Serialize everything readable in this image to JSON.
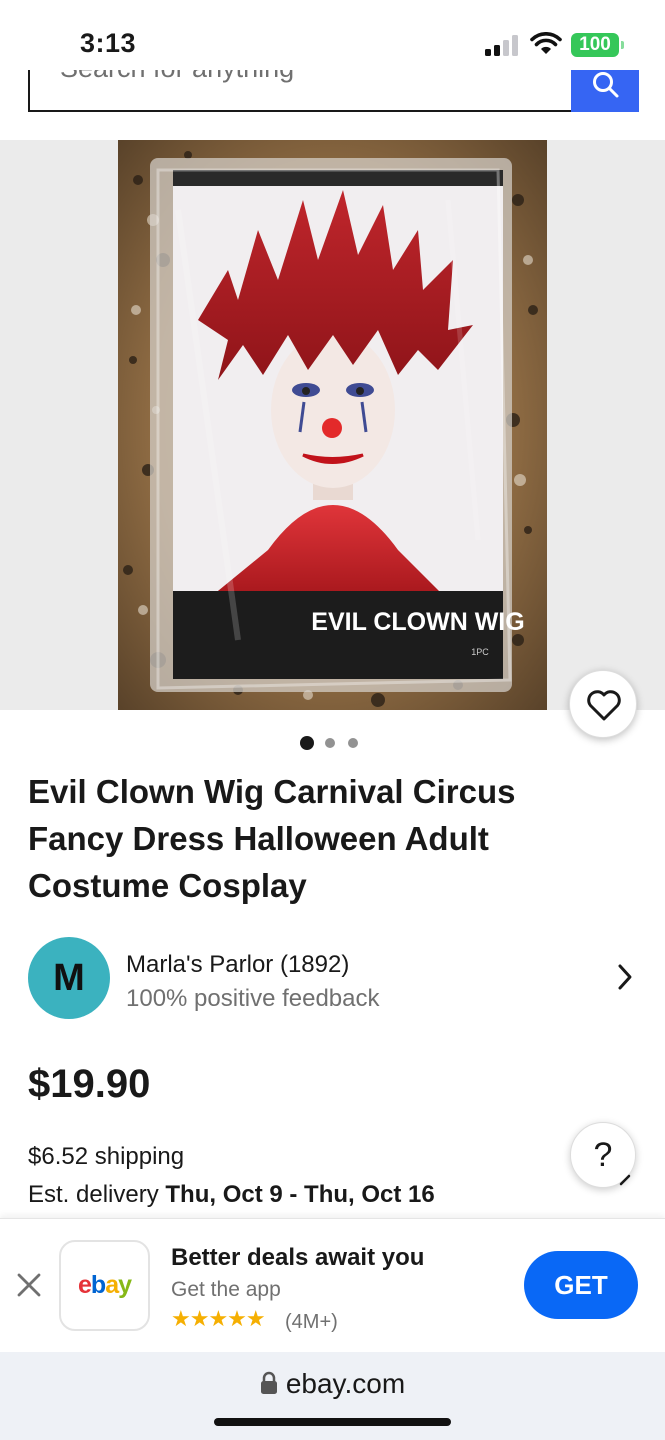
{
  "status_bar": {
    "time": "3:13",
    "battery": "100"
  },
  "search": {
    "placeholder": "Search for anything"
  },
  "listing": {
    "title": "Evil Clown Wig Carnival Circus Fancy Dress Halloween Adult Costume Cosplay",
    "image_dots": 3,
    "active_image_index": 0,
    "package_label": "EVIL CLOWN WIG",
    "package_count": "1PC"
  },
  "seller": {
    "initial": "M",
    "name": "Marla's Parlor (1892)",
    "feedback": "100% positive feedback"
  },
  "pricing": {
    "price": "$19.90",
    "shipping": "$6.52 shipping",
    "delivery_prefix": "Est. delivery ",
    "delivery_dates": "Thu, Oct 9 - Thu, Oct 16"
  },
  "help": {
    "label": "?"
  },
  "app_banner": {
    "heading": "Better deals await you",
    "subheading": "Get the app",
    "stars": "★★★★★",
    "review_count": "(4M+)",
    "get_label": "GET",
    "app_logo": {
      "e": "e",
      "b": "b",
      "a": "a",
      "y": "y"
    }
  },
  "browser": {
    "url": "ebay.com"
  },
  "colors": {
    "accent_blue": "#3665f3",
    "get_button": "#0968f6",
    "avatar": "#3bb2bf",
    "battery": "#35c759"
  }
}
